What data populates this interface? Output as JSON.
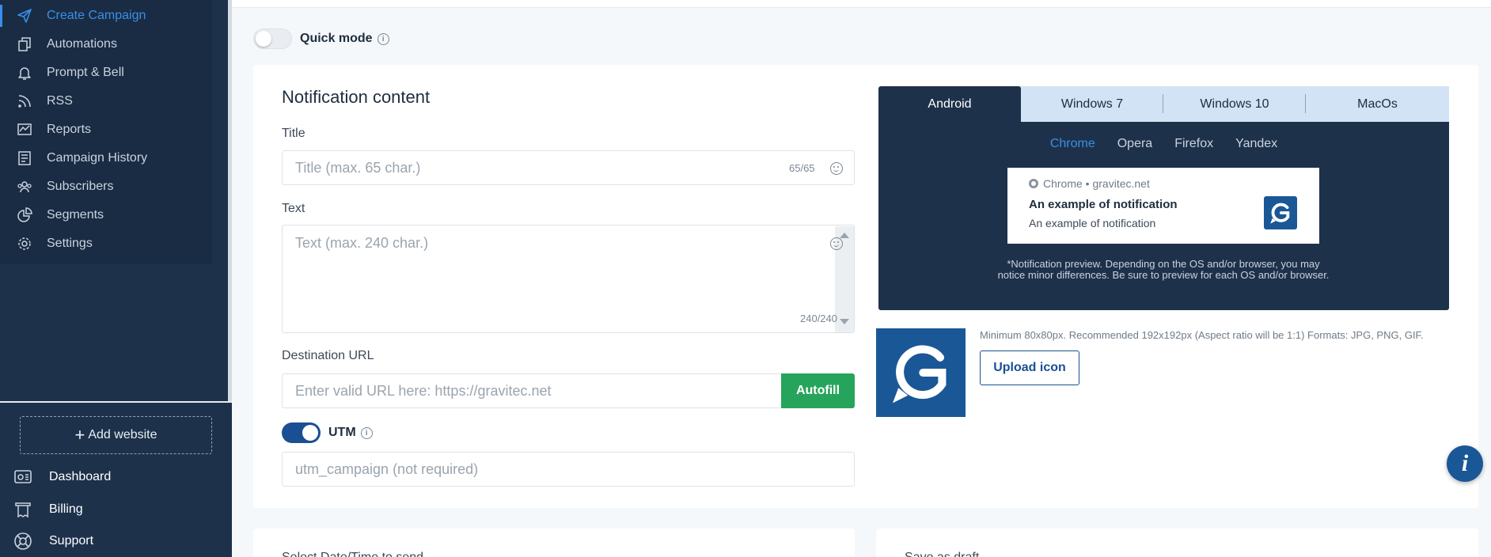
{
  "sidebar": {
    "items": [
      {
        "label": "Create Campaign",
        "icon": "send-icon"
      },
      {
        "label": "Automations",
        "icon": "automations-icon"
      },
      {
        "label": "Prompt & Bell",
        "icon": "bell-icon"
      },
      {
        "label": "RSS",
        "icon": "rss-icon"
      },
      {
        "label": "Reports",
        "icon": "reports-icon"
      },
      {
        "label": "Campaign History",
        "icon": "history-icon"
      },
      {
        "label": "Subscribers",
        "icon": "subscribers-icon"
      },
      {
        "label": "Segments",
        "icon": "segments-icon"
      },
      {
        "label": "Settings",
        "icon": "gear-icon"
      }
    ],
    "add_website": "Add website",
    "footer": [
      {
        "label": "Dashboard",
        "icon": "dashboard-icon"
      },
      {
        "label": "Billing",
        "icon": "billing-icon"
      },
      {
        "label": "Support",
        "icon": "support-icon"
      }
    ]
  },
  "quick_mode": {
    "label": "Quick mode",
    "enabled": false
  },
  "notification": {
    "heading": "Notification content",
    "title_label": "Title",
    "title_placeholder": "Title (max. 65 char.)",
    "title_counter": "65/65",
    "text_label": "Text",
    "text_placeholder": "Text (max. 240 char.)",
    "text_counter": "240/240",
    "url_label": "Destination URL",
    "url_placeholder": "Enter valid URL here: https://gravitec.net",
    "autofill_label": "Autofill",
    "utm_label": "UTM",
    "utm_enabled": true,
    "utm_placeholder": "utm_campaign (not required)"
  },
  "preview": {
    "os_tabs": [
      "Android",
      "Windows 7",
      "Windows 10",
      "MacOs"
    ],
    "active_os": "Android",
    "browser_tabs": [
      "Chrome",
      "Opera",
      "Firefox",
      "Yandex"
    ],
    "active_browser": "Chrome",
    "source": "Chrome • gravitec.net",
    "title": "An example of notification",
    "text": "An example of notification",
    "note": "*Notification preview. Depending on the OS and/or browser, you may notice minor differences. Be sure to preview for each OS and/or browser."
  },
  "icon_upload": {
    "hint": "Minimum 80x80px. Recommended 192x192px (Aspect ratio will be 1:1) Formats: JPG, PNG, GIF.",
    "button": "Upload icon"
  },
  "lower_cards": {
    "left_label": "Select Date/Time to send",
    "right_label": "Save as draft"
  },
  "colors": {
    "sidebar_bg": "#1e314b",
    "accent": "#3a8ee8",
    "brand": "#1a5796",
    "success": "#27a45b"
  }
}
